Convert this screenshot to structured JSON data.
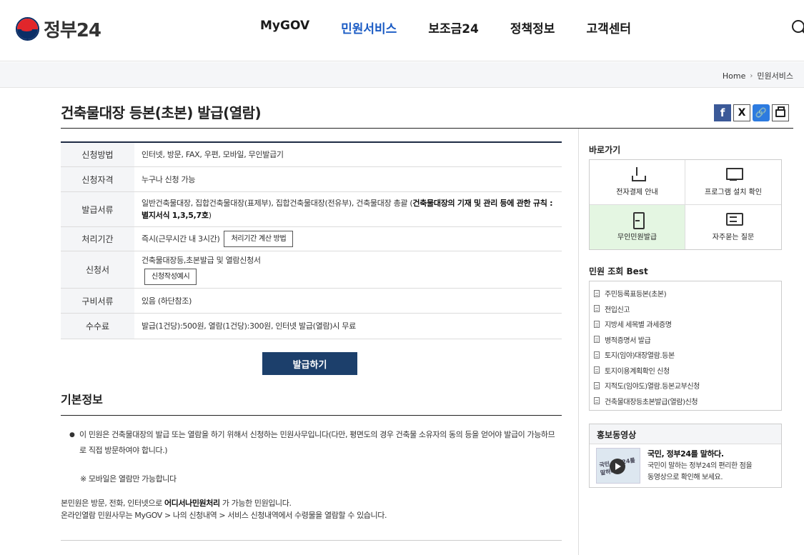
{
  "header": {
    "logo_text": "정부24",
    "nav": [
      "MyGOV",
      "민원서비스",
      "보조금24",
      "정책정보",
      "고객센터"
    ],
    "active_nav": "민원서비스"
  },
  "breadcrumb": {
    "home": "Home",
    "current": "민원서비스"
  },
  "page_title": "건축물대장 등본(초본) 발급(열람)",
  "share": {
    "x_label": "X",
    "link_label": "🔗"
  },
  "info": {
    "method_label": "신청방법",
    "method_value": "인터넷, 방문, FAX, 우편, 모바일, 무인발급기",
    "eligibility_label": "신청자격",
    "eligibility_value": "누구나 신청 가능",
    "docs_label": "발급서류",
    "docs_value": "일반건축물대장, 집합건축물대장(표제부), 집합건축물대장(전유부), 건축물대장 총괄 (",
    "docs_bold": "건축물대장의 기재 및 관리 등에 관한 규칙 : 별지서식 1,3,5,7호",
    "docs_close": ")",
    "period_label": "처리기간",
    "period_value": "즉시(근무시간 내 3시간)",
    "period_button": "처리기간 계산 방법",
    "form_label": "신청서",
    "form_value": "건축물대장등,초본발급 및 열람신청서",
    "form_button": "신청작성예시",
    "required_label": "구비서류",
    "required_value": "있음 (하단참조)",
    "fee_label": "수수료",
    "fee_value": "발급(1건당):500원, 열람(1건당):300원, 인터넷 발급(열람)시 무료"
  },
  "issue_button": "발급하기",
  "basic": {
    "title": "기본정보",
    "bullet": "이 민원은 건축물대장의 발급 또는 열람을 하기 위해서 신청하는 민원사무입니다(다만, 평면도의 경우 건축물 소유자의 동의 등을 얻어야 발급이 가능하므로 직접 방문하여야 합니다.)",
    "note": "※ 모바일은 열람만 가능합니다",
    "para1_pre": "본민원은 방문, 전화, 인터넷으로 ",
    "para1_bold": "어디서나민원처리",
    "para1_post": " 가 가능한 민원입니다.",
    "para2": "온라인열람 민원사무는 MyGOV > 나의 신청내역 > 서비스 신청내역에서 수령물을 열람할 수 있습니다."
  },
  "quick": {
    "title": "바로가기",
    "items": [
      {
        "label": "전자결제 안내",
        "icon": "download-icon"
      },
      {
        "label": "프로그램 설치 확인",
        "icon": "monitor-icon"
      },
      {
        "label": "무인민원발급",
        "icon": "kiosk-icon"
      },
      {
        "label": "자주묻는 질문",
        "icon": "chat-icon"
      }
    ]
  },
  "best": {
    "title": "민원 조회 Best",
    "items": [
      "주민등록표등본(초본)",
      "전입신고",
      "지방세 세목별 과세증명",
      "병적증명서 발급",
      "토지(임야)대장열람.등본",
      "토지이용계획확인 신청",
      "지적도(임야도)열람.등본교부신청",
      "건축물대장등초본발급(열람)신청"
    ]
  },
  "promo": {
    "title": "홍보동영상",
    "thumb_text": "국민 정부24를 말하다",
    "headline": "국민, 정부24를 말하다.",
    "desc1": "국민이 말하는 정부24의 편리한 점을",
    "desc2": "동영상으로 확인해 보세요."
  },
  "colors": {
    "primary": "#1c3f6b",
    "active_nav": "#1a5bc4",
    "highlight": "#e4f6e2"
  }
}
